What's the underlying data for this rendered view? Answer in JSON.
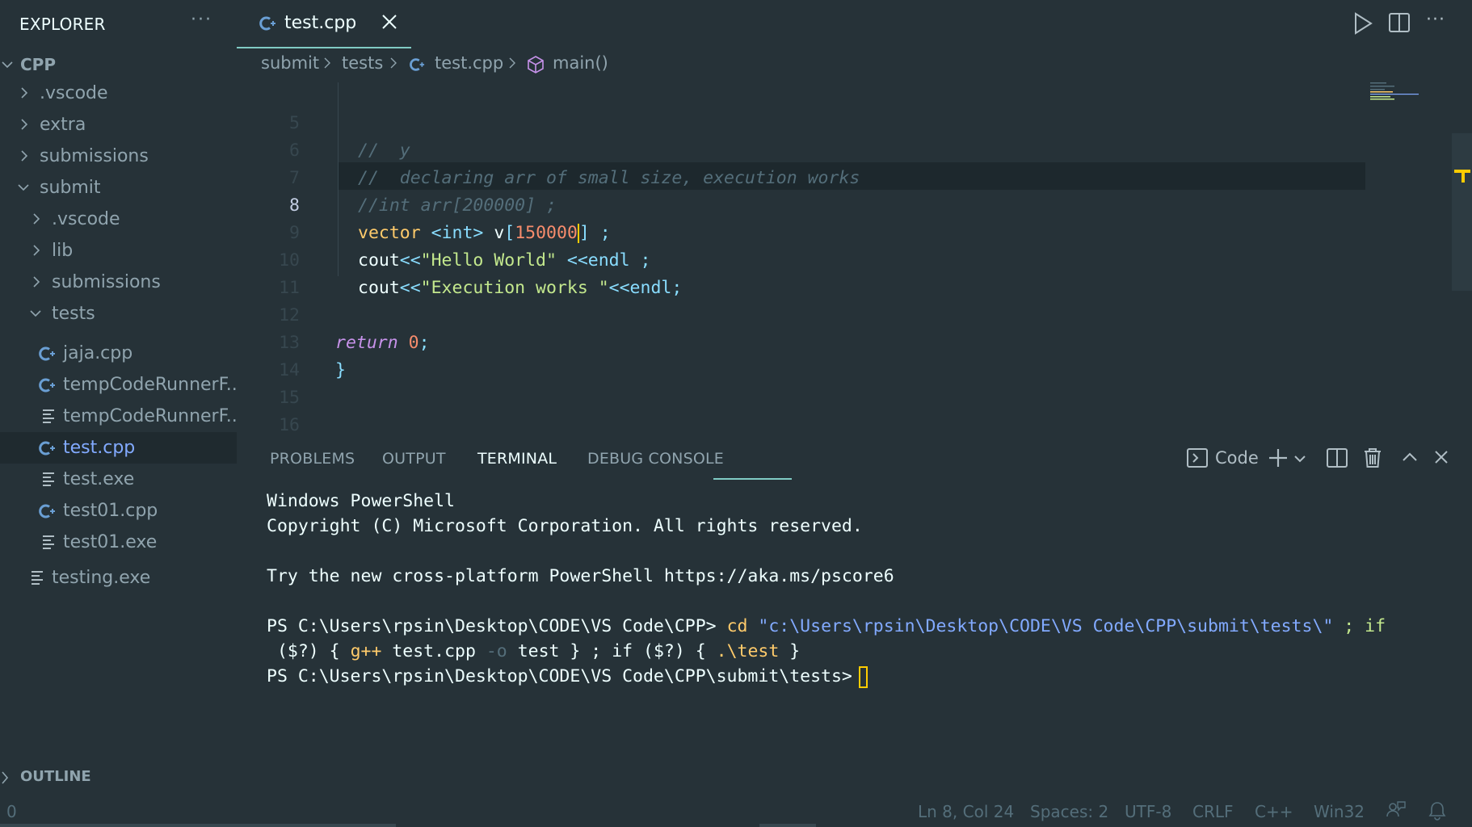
{
  "sidebar": {
    "title": "EXPLORER",
    "more": "···",
    "root": "CPP",
    "items": [
      {
        "label": ".vscode",
        "icon": "chevron-right"
      },
      {
        "label": "extra",
        "icon": "chevron-right"
      },
      {
        "label": "submissions",
        "icon": "chevron-right"
      },
      {
        "label": "submit",
        "icon": "chevron-down"
      },
      {
        "label": ".vscode",
        "icon": "chevron-right"
      },
      {
        "label": "lib",
        "icon": "chevron-right"
      },
      {
        "label": "submissions",
        "icon": "chevron-right"
      },
      {
        "label": "tests",
        "icon": "chevron-down"
      },
      {
        "label": "jaja.cpp",
        "icon": "cpp-file-icon"
      },
      {
        "label": "tempCodeRunnerF...",
        "icon": "cpp-file-icon"
      },
      {
        "label": "tempCodeRunnerF...",
        "icon": "text-file-icon"
      },
      {
        "label": "test.cpp",
        "icon": "cpp-file-icon",
        "selected": true
      },
      {
        "label": "test.exe",
        "icon": "text-file-icon"
      },
      {
        "label": "test01.cpp",
        "icon": "cpp-file-icon"
      },
      {
        "label": "test01.exe",
        "icon": "text-file-icon"
      },
      {
        "label": "testing.exe",
        "icon": "text-file-icon"
      }
    ],
    "outline": "OUTLINE"
  },
  "tab": {
    "label": "test.cpp"
  },
  "breadcrumb": {
    "part1": "submit",
    "part2": "tests",
    "part3": "test.cpp",
    "part4": "main()"
  },
  "editor": {
    "lines": [
      {
        "n": "5"
      },
      {
        "n": "6"
      },
      {
        "n": "7"
      },
      {
        "n": "8"
      },
      {
        "n": "9"
      },
      {
        "n": "10"
      },
      {
        "n": "11"
      },
      {
        "n": "12"
      },
      {
        "n": "13"
      },
      {
        "n": "14"
      },
      {
        "n": "15"
      },
      {
        "n": "16"
      }
    ],
    "code": {
      "l5": "//  y",
      "l6": "//  declaring arr of small size, execution works",
      "l7": "//int arr[200000] ;",
      "l8_a": "vector",
      "l8_b": "<int>",
      "l8_c": "v",
      "l8_d": "[",
      "l8_e": "150000",
      "l8_f": "]",
      "l8_g": " ;",
      "l9_a": "cout",
      "l9_b": "<<",
      "l9_c": "\"Hello World\"",
      "l9_d": " <<endl",
      "l9_e": " ;",
      "l10_a": "cout",
      "l10_b": "<<",
      "l10_c": "\"Execution works \"",
      "l10_d": "<<endl",
      "l10_e": ";",
      "l12_a": "return",
      "l12_b": "0",
      "l12_c": ";",
      "l13": "}"
    }
  },
  "panel": {
    "tabs": {
      "problems": "PROBLEMS",
      "output": "OUTPUT",
      "terminal": "TERMINAL",
      "debug": "DEBUG CONSOLE"
    },
    "shell_label": "Code"
  },
  "terminal": {
    "l1": "Windows PowerShell",
    "l2": "Copyright (C) Microsoft Corporation. All rights reserved.",
    "l3": "Try the new cross-platform PowerShell https://aka.ms/pscore6",
    "l4_prompt": "PS C:\\Users\\rpsin\\Desktop\\CODE\\VS Code\\CPP>",
    "l4_cmd": "cd",
    "l4_path": "\"c:\\Users\\rpsin\\Desktop\\CODE\\VS Code\\CPP\\submit\\tests\\\"",
    "l4_rest": " ; if",
    "l5_a": " ($?) { ",
    "l5_gpp": "g++",
    "l5_b": " test.cpp ",
    "l5_o": "-o",
    "l5_c": " test } ; if ($?) { ",
    "l5_run": ".\\test",
    "l5_d": " }",
    "l6_prompt": "PS C:\\Users\\rpsin\\Desktop\\CODE\\VS Code\\CPP\\submit\\tests>"
  },
  "status": {
    "left": "0",
    "position": "Ln 8, Col 24",
    "spaces": "Spaces: 2",
    "encoding": "UTF-8",
    "eol": "CRLF",
    "language": "C++",
    "platform": "Win32"
  }
}
